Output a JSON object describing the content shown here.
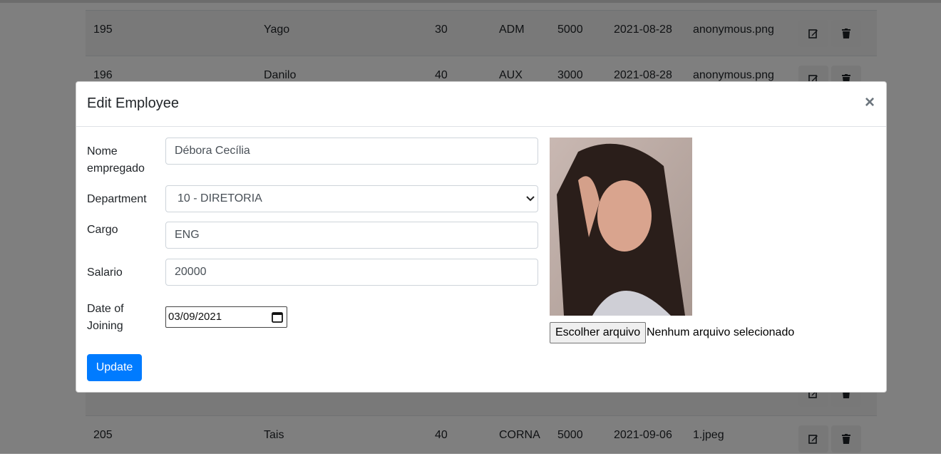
{
  "background_table": {
    "rows": [
      {
        "id": "195",
        "name": "Yago",
        "dept": "30",
        "role": "ADM",
        "salary": "5000",
        "date": "2021-08-28",
        "photo": "anonymous.png"
      },
      {
        "id": "196",
        "name": "Danilo",
        "dept": "40",
        "role": "AUX",
        "salary": "3000",
        "date": "2021-08-28",
        "photo": "anonymous.png"
      },
      {
        "id": "205",
        "name": "Tais",
        "dept": "40",
        "role": "CORNA",
        "salary": "5000",
        "date": "2021-09-06",
        "photo": "1.jpeg"
      }
    ]
  },
  "modal": {
    "title": "Edit Employee",
    "close_label": "×",
    "fields": {
      "name_label": "Nome empregado",
      "name_value": "Débora Cecília",
      "department_label": "Department",
      "department_value": "10 - DIRETORIA",
      "cargo_label": "Cargo",
      "cargo_value": "ENG",
      "salario_label": "Salario",
      "salario_value": "20000",
      "date_label": "Date of Joining",
      "date_value": "03/09/2021"
    },
    "file_button_label": "Escolher arquivo",
    "file_status": "Nenhum arquivo selecionado",
    "update_label": "Update"
  },
  "colors": {
    "primary": "#007bff",
    "backdrop": "rgba(0,0,0,0.5)"
  }
}
